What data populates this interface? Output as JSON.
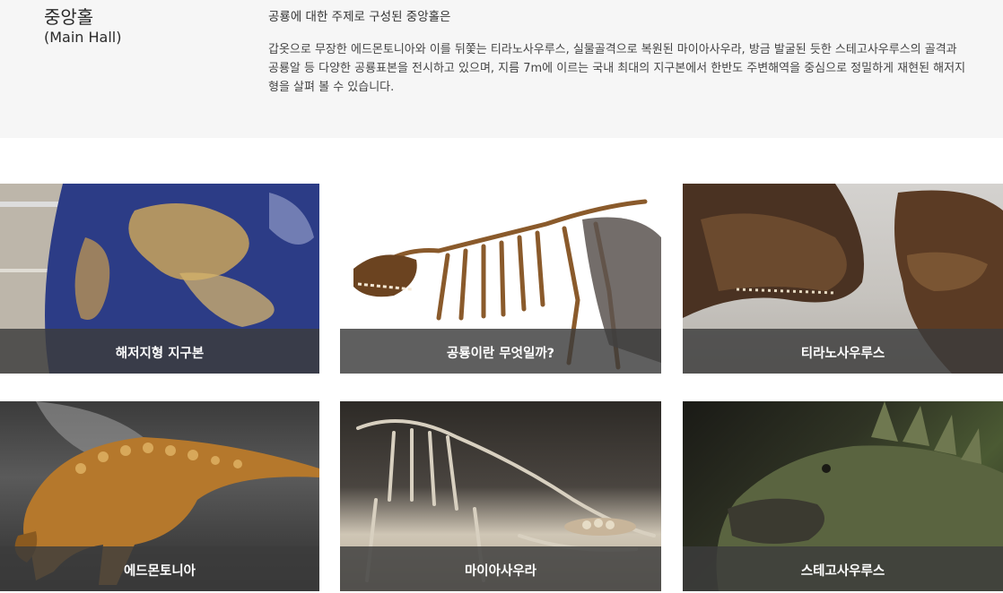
{
  "hall": {
    "title": "중앙홀",
    "subtitle": "(Main Hall)",
    "heading": "공룡에 대한 주제로 구성된 중앙홀은",
    "description": "갑옷으로 무장한 에드몬토니아와 이를 뒤쫓는 티라노사우루스, 실물골격으로 복원된 마이아사우라, 방금 발굴된 듯한 스테고사우루스의 골격과 공룡알 등 다양한 공룡표본을 전시하고 있으며, 지름 7m에 이르는 국내 최대의 지구본에서 한반도 주변해역을 중심으로 정밀하게 재현된 해저지형을 살펴 볼 수 있습니다."
  },
  "cards": [
    {
      "label": "해저지형 지구본"
    },
    {
      "label": "공룡이란 무엇일까?"
    },
    {
      "label": "티라노사우루스"
    },
    {
      "label": "에드몬토니아"
    },
    {
      "label": "마이아사우라"
    },
    {
      "label": "스테고사우루스"
    }
  ]
}
